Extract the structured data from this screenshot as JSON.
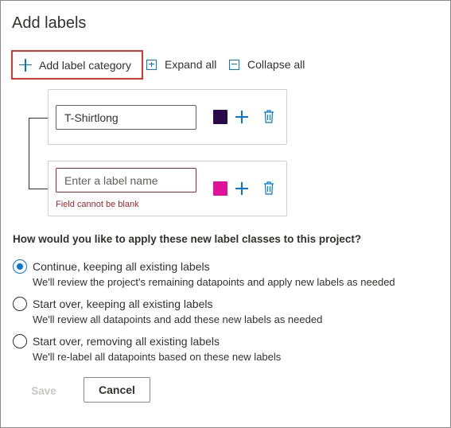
{
  "dialog": {
    "title": "Add labels"
  },
  "toolbar": {
    "add_category_label": "Add label category",
    "expand_all_label": "Expand all",
    "collapse_all_label": "Collapse all"
  },
  "labels": [
    {
      "value": "T-Shirtlong",
      "placeholder": "",
      "color": "#2a0b47",
      "error": ""
    },
    {
      "value": "",
      "placeholder": "Enter a label name",
      "color": "#e0119a",
      "error": "Field cannot be blank"
    }
  ],
  "apply": {
    "question": "How would you like to apply these new label classes to this project?",
    "options": [
      {
        "label": "Continue, keeping all existing labels",
        "description": "We'll review the project's remaining datapoints and apply new labels as needed",
        "selected": true
      },
      {
        "label": "Start over, keeping all existing labels",
        "description": "We'll review all datapoints and add these new labels as needed",
        "selected": false
      },
      {
        "label": "Start over, removing all existing labels",
        "description": "We'll re-label all datapoints based on these new labels",
        "selected": false
      }
    ]
  },
  "footer": {
    "save_label": "Save",
    "cancel_label": "Cancel"
  },
  "colors": {
    "accent": "#0078d4",
    "error": "#a4262c",
    "highlight": "#e0322f"
  },
  "icons": {
    "add": "plus-icon",
    "expand": "expand-all-icon",
    "collapse": "collapse-all-icon",
    "delete": "trash-icon"
  }
}
